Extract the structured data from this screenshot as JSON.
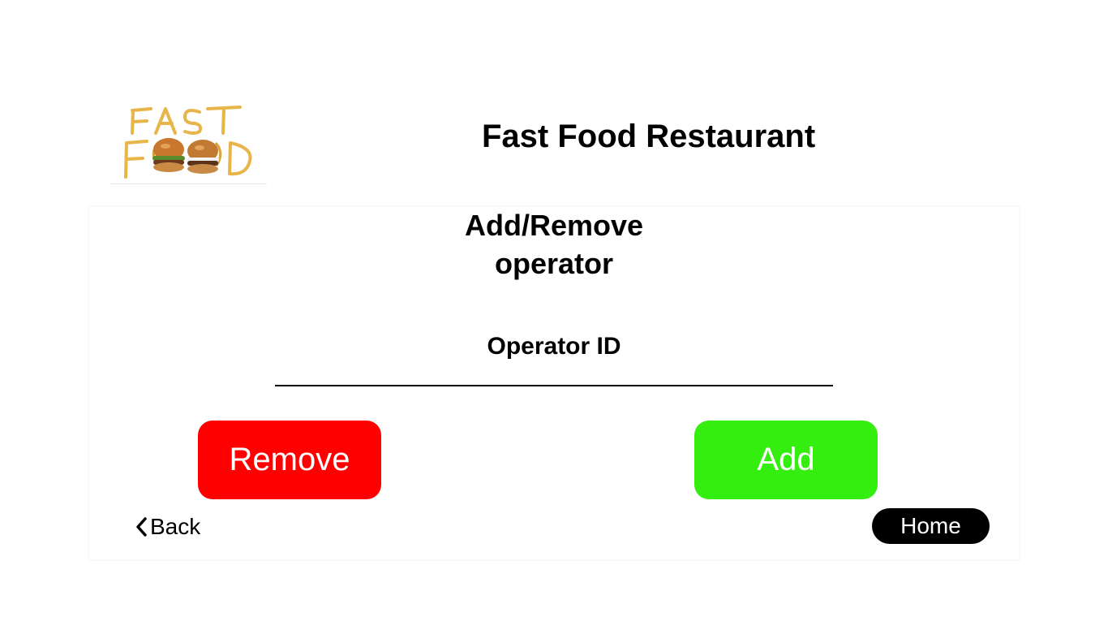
{
  "header": {
    "title": "Fast Food Restaurant",
    "logo_icon": "fast-food-logo"
  },
  "form": {
    "title_line1": "Add/Remove",
    "title_line2": "operator",
    "field_label": "Operator ID",
    "field_value": "",
    "field_placeholder": ""
  },
  "actions": {
    "remove_label": "Remove",
    "add_label": "Add",
    "remove_color": "#ff0000",
    "add_color": "#33ee0e"
  },
  "nav": {
    "back_label": "Back",
    "back_icon": "chevron-left-icon",
    "home_label": "Home"
  }
}
